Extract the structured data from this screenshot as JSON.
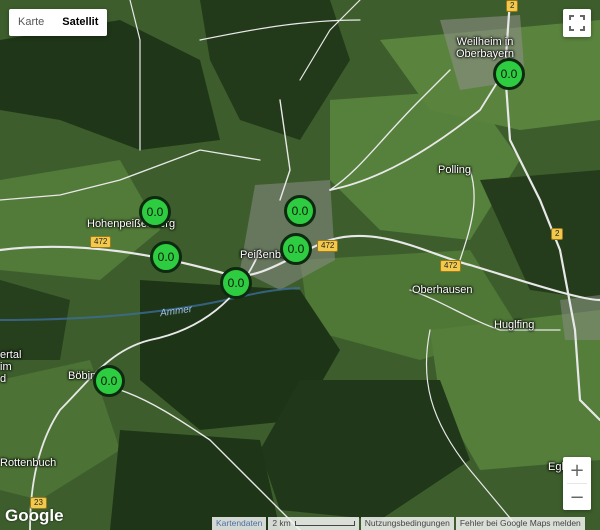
{
  "map_type": {
    "map_label": "Karte",
    "satellite_label": "Satellit",
    "selected": "Satellit"
  },
  "places": {
    "weilheim": "Weilheim in Oberbayern",
    "polling": "Polling",
    "hohenpeissenberg": "Hohenpeißenberg",
    "peissenberg": "Peißenberg",
    "oberhausen": "Oberhausen",
    "hugling": "Huglfing",
    "boebing": "Böbing",
    "rottenbuch": "Rottenbuch",
    "eglfing": "Eglfing",
    "vertal": "ertal im\nd"
  },
  "water": {
    "ammer": "Ammer"
  },
  "road_shields": {
    "r2_top": "2",
    "r2_right": "2",
    "r472_a": "472",
    "r472_b": "472",
    "r472_c": "472",
    "r23": "23"
  },
  "markers": [
    {
      "name": "marker-weilheim",
      "value": "0.0"
    },
    {
      "name": "marker-peissenberg-north",
      "value": "0.0"
    },
    {
      "name": "marker-peissenberg-center",
      "value": "0.0"
    },
    {
      "name": "marker-hohenpeissenberg-north",
      "value": "0.0"
    },
    {
      "name": "marker-hohenpeissenberg-south",
      "value": "0.0"
    },
    {
      "name": "marker-ammer",
      "value": "0.0"
    },
    {
      "name": "marker-boebing",
      "value": "0.0"
    }
  ],
  "controls": {
    "zoom_in": "+",
    "zoom_out": "−",
    "fullscreen_icon": "fullscreen-icon"
  },
  "footer": {
    "logo": "Google",
    "map_data": "Kartendaten",
    "scale": "2 km",
    "terms": "Nutzungsbedingungen",
    "report": "Fehler bei Google Maps melden"
  },
  "colors": {
    "marker_fill": "#2ecc40",
    "marker_border": "#0d2a10",
    "road": "#e8e8e8",
    "shield": "#f2c94c"
  }
}
